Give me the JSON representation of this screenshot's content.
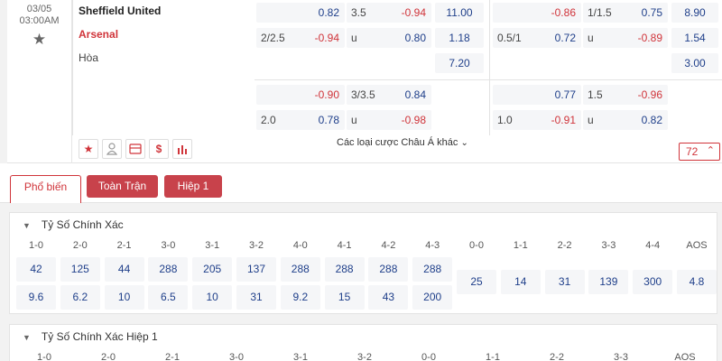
{
  "match": {
    "date": "03/05",
    "time": "03:00AM",
    "home": "Sheffield United",
    "away": "Arsenal",
    "draw": "Hòa"
  },
  "odds": {
    "row1": [
      {
        "line": "",
        "value": "0.82",
        "color": "blue"
      },
      {
        "line": "3.5",
        "value": "-0.94",
        "color": "red"
      },
      {
        "line": "",
        "value": "11.00",
        "color": "blue"
      },
      {
        "line": "",
        "value": "-0.86",
        "color": "red"
      },
      {
        "line": "1/1.5",
        "value": "0.75",
        "color": "blue"
      },
      {
        "line": "",
        "value": "8.90",
        "color": "blue"
      }
    ],
    "row2": [
      {
        "line": "2/2.5",
        "value": "-0.94",
        "color": "red"
      },
      {
        "line": "u",
        "value": "0.80",
        "color": "blue"
      },
      {
        "line": "",
        "value": "1.18",
        "color": "blue"
      },
      {
        "line": "0.5/1",
        "value": "0.72",
        "color": "blue"
      },
      {
        "line": "u",
        "value": "-0.89",
        "color": "red"
      },
      {
        "line": "",
        "value": "1.54",
        "color": "blue"
      }
    ],
    "row3": [
      {
        "line": "",
        "value": "7.20",
        "color": "blue"
      },
      {
        "line": "",
        "value": "3.00",
        "color": "blue"
      }
    ],
    "row4": [
      {
        "line": "",
        "value": "-0.90",
        "color": "red"
      },
      {
        "line": "3/3.5",
        "value": "0.84",
        "color": "blue"
      },
      {
        "line": "",
        "value": "0.77",
        "color": "blue"
      },
      {
        "line": "1.5",
        "value": "-0.96",
        "color": "red"
      }
    ],
    "row5": [
      {
        "line": "2.0",
        "value": "0.78",
        "color": "blue"
      },
      {
        "line": "u",
        "value": "-0.98",
        "color": "red"
      },
      {
        "line": "1.0",
        "value": "-0.91",
        "color": "red"
      },
      {
        "line": "u",
        "value": "0.82",
        "color": "blue"
      }
    ]
  },
  "toolbar": {
    "icons": [
      "star-icon",
      "person-icon",
      "card-icon",
      "dollar-icon",
      "chart-icon"
    ],
    "more_label": "Các loại cược Châu Á khác",
    "count": "72"
  },
  "tabs": [
    "Phổ biến",
    "Toàn Trận",
    "Hiệp 1"
  ],
  "correct_score": {
    "title": "Tỷ Số Chính Xác",
    "headers": [
      "1-0",
      "2-0",
      "2-1",
      "3-0",
      "3-1",
      "3-2",
      "4-0",
      "4-1",
      "4-2",
      "4-3",
      "0-0",
      "1-1",
      "2-2",
      "3-3",
      "4-4",
      "AOS"
    ],
    "row1": [
      "42",
      "125",
      "44",
      "288",
      "205",
      "137",
      "288",
      "288",
      "288",
      "288"
    ],
    "row2": [
      "9.6",
      "6.2",
      "10",
      "6.5",
      "10",
      "31",
      "9.2",
      "15",
      "43",
      "200"
    ],
    "draws": [
      "25",
      "14",
      "31",
      "139",
      "300",
      "4.8"
    ]
  },
  "correct_score_h1": {
    "title": "Tỷ Số Chính Xác Hiệp 1",
    "headers": [
      "1-0",
      "2-0",
      "2-1",
      "3-0",
      "3-1",
      "3-2",
      "0-0",
      "1-1",
      "2-2",
      "3-3",
      "AOS"
    ]
  },
  "colors": {
    "accent": "#d0343a",
    "value_blue": "#1f3f8a",
    "cell_bg": "#f5f6f8"
  }
}
